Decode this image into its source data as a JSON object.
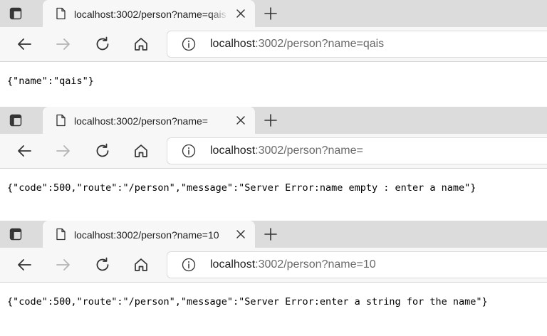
{
  "colors": {
    "tabstrip": "#dcdcdc",
    "toolbar": "#f7f7f7",
    "url_host": "#1f1f1f",
    "url_path": "#6a6a6a",
    "forward_disabled": "#b5b5b5"
  },
  "icons": {
    "tab_actions": "tab-actions-icon",
    "favicon": "page-icon",
    "close": "close-icon",
    "new_tab": "plus-icon",
    "back": "arrow-left-icon",
    "forward": "arrow-right-icon",
    "reload": "refresh-icon",
    "home": "home-icon",
    "info": "info-icon"
  },
  "windows": [
    {
      "tab_title": "localhost:3002/person?name=qais",
      "url_host": "localhost",
      "url_path": ":3002/person?name=qais",
      "body": "{\"name\":\"qais\"}"
    },
    {
      "tab_title": "localhost:3002/person?name=",
      "url_host": "localhost",
      "url_path": ":3002/person?name=",
      "body": "{\"code\":500,\"route\":\"/person\",\"message\":\"Server Error:name empty : enter a name\"}"
    },
    {
      "tab_title": "localhost:3002/person?name=10",
      "url_host": "localhost",
      "url_path": ":3002/person?name=10",
      "body": "{\"code\":500,\"route\":\"/person\",\"message\":\"Server Error:enter a string for the name\"}"
    }
  ]
}
